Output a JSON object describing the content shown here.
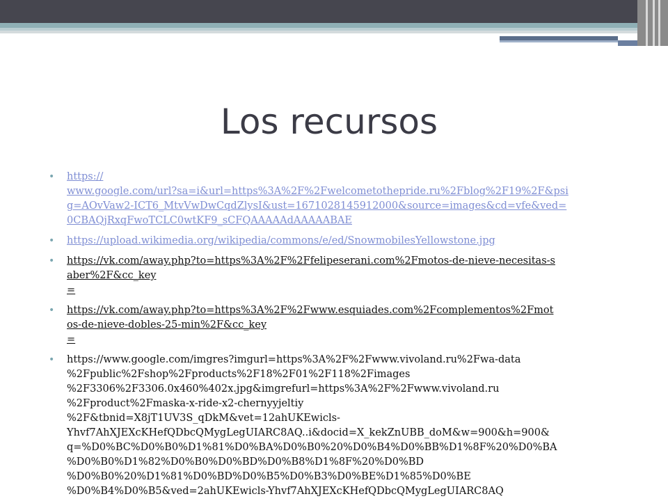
{
  "slide": {
    "title": "Los recursos",
    "bullets": [
      {
        "text": "https://\nwww.google.com/url?sa=i&url=https%3A%2F%2Fwelcometothepride.ru%2Fblog%2F19%2F&psi\ng=AOvVaw2-ICT6_MtvVwDwCqdZlysI&ust=1671028145912000&source=images&cd=vfe&ved=\n0CBAQjRxqFwoTCLC0wtKF9_sCFQAAAAAdAAAAABAE",
        "style": "link-blue"
      },
      {
        "text": "https://upload.wikimedia.org/wikipedia/commons/e/ed/SnowmobilesYellowstone.jpg",
        "style": "link-blue"
      },
      {
        "text": "https://vk.com/away.php?to=https%3A%2F%2Ffelipeserani.com%2Fmotos-de-nieve-necesitas-s\naber%2F&cc_key\n=",
        "style": "link-black"
      },
      {
        "text": "https://vk.com/away.php?to=https%3A%2F%2Fwww.esquiades.com%2Fcomplementos%2Fmot\nos-de-nieve-dobles-25-min%2F&cc_key\n=",
        "style": "link-black"
      },
      {
        "text": "https://www.google.com/imgres?imgurl=https%3A%2F%2Fwww.vivoland.ru%2Fwa-data\n%2Fpublic%2Fshop%2Fproducts%2F18%2F01%2F118%2Fimages\n%2F3306%2F3306.0x460%402x.jpg&imgrefurl=https%3A%2F%2Fwww.vivoland.ru\n%2Fproduct%2Fmaska-x-ride-x2-chernyyjeltiy\n%2F&tbnid=X8jT1UV3S_qDkM&vet=12ahUKEwicls-\nYhvf7AhXJEXcKHefQDbcQMygLegUIARC8AQ..i&docid=X_kekZnUBB_doM&w=900&h=900&\nq=%D0%BC%D0%B0%D1%81%D0%BA%D0%B0%20%D0%B4%D0%BB%D1%8F%20%D0%BA\n%D0%B0%D1%82%D0%B0%D0%BD%D0%B8%D1%8F%20%D0%BD\n%D0%B0%20%D1%81%D0%BD%D0%B5%D0%B3%D0%BE%D1%85%D0%BE\n%D0%B4%D0%B5&ved=2ahUKEwicls-Yhvf7AhXJEXcKHefQDbcQMygLegUIARC8AQ",
        "style": "plain"
      }
    ],
    "bullet_glyph": "•",
    "colors": {
      "title": "#3b3b46",
      "link_blue": "#7f8ed4",
      "text": "#111111",
      "bullet": "#7aa6b0",
      "top_bar": "#46464f",
      "accent_teal": "#8fb0b6"
    }
  }
}
